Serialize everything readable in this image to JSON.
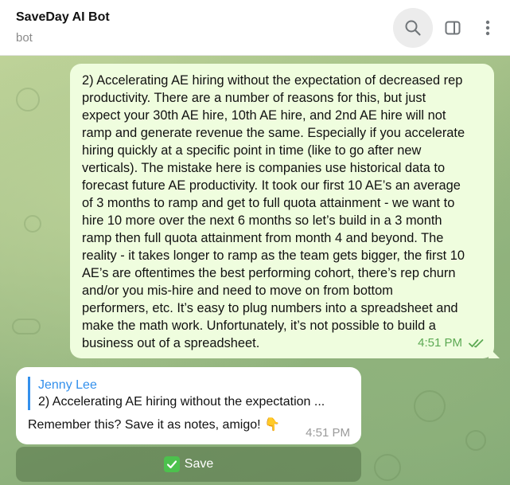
{
  "header": {
    "title": "SaveDay AI Bot",
    "subtitle": "bot",
    "icons": [
      "search-icon",
      "side-panel-icon",
      "more-vertical-icon"
    ]
  },
  "messages": {
    "outgoing": {
      "lines": [
        "2) Accelerating AE hiring without the expectation of decreased rep",
        "productivity. There are a number of reasons for this, but just",
        "expect your 30th AE hire, 10th AE hire, and 2nd AE hire will not",
        "ramp and generate revenue the same. Especially if you accelerate",
        "hiring quickly at a specific point in time (like to go after new",
        "verticals). The mistake here is companies use historical data to",
        "forecast future AE productivity. It took our first 10 AE’s an average",
        "of 3 months to ramp and get to full quota attainment - we want to",
        "hire 10 more over the next 6 months so let’s build in a 3 month",
        "ramp then full quota attainment from month 4 and beyond. The",
        "reality - it takes longer to ramp as the team gets bigger, the first 10",
        "AE’s are oftentimes the best performing cohort, there’s rep churn",
        "and/or you mis-hire and need to move on from bottom",
        "performers, etc. It’s easy to plug numbers into a spreadsheet and",
        "make the math work. Unfortunately, it’s not possible to build a",
        "business out of a spreadsheet."
      ],
      "time": "4:51 PM",
      "status_icon": "double-check-icon"
    },
    "incoming": {
      "reply_name": "Jenny Lee",
      "reply_text": "2) Accelerating AE hiring without the expectation ...",
      "text": "Remember this? Save it as notes, amigo! 👇",
      "time": "4:51 PM"
    }
  },
  "keyboard": {
    "save_button": "Save",
    "save_icon": "check-mark-button-icon"
  },
  "colors": {
    "outgoing_bubble": "#effdde",
    "incoming_bubble": "#ffffff",
    "accent": "#3390ec",
    "time_outgoing": "#5ca953"
  }
}
